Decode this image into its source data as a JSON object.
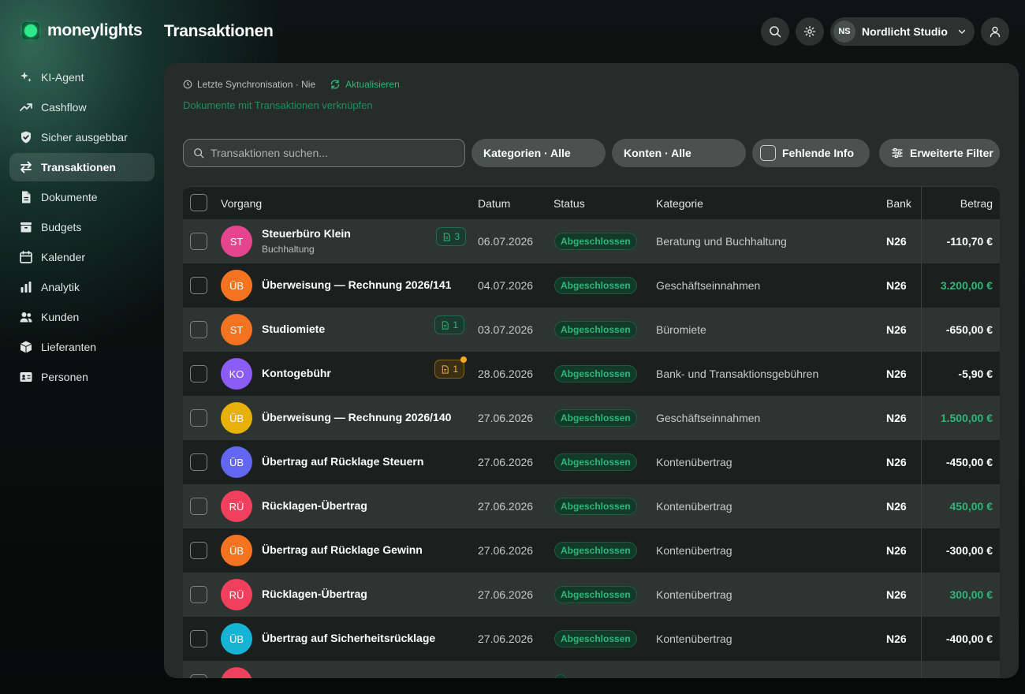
{
  "app": {
    "logo": "moneylights",
    "page_title": "Transaktionen"
  },
  "sidebar": {
    "items": [
      {
        "label": "KI-Agent",
        "icon": "sparkle-icon",
        "active": false
      },
      {
        "label": "Cashflow",
        "icon": "trend-up-icon",
        "active": false
      },
      {
        "label": "Sicher ausgebbar",
        "icon": "shield-check-icon",
        "active": false
      },
      {
        "label": "Transaktionen",
        "icon": "arrows-exchange-icon",
        "active": true
      },
      {
        "label": "Dokumente",
        "icon": "document-icon",
        "active": false
      },
      {
        "label": "Budgets",
        "icon": "wallet-icon",
        "active": false
      },
      {
        "label": "Kalender",
        "icon": "calendar-icon",
        "active": false
      },
      {
        "label": "Analytik",
        "icon": "bar-chart-icon",
        "active": false
      },
      {
        "label": "Kunden",
        "icon": "users-icon",
        "active": false
      },
      {
        "label": "Lieferanten",
        "icon": "box-icon",
        "active": false
      },
      {
        "label": "Personen",
        "icon": "id-card-icon",
        "active": false
      }
    ]
  },
  "header": {
    "org_initials": "NS",
    "org_name": "Nordlicht Studio"
  },
  "sync": {
    "label": "Letzte Synchronisation · Nie",
    "refresh_label": "Aktualisieren",
    "link_docs": "Dokumente mit Transaktionen verknüpfen"
  },
  "filters": {
    "search_placeholder": "Transaktionen suchen...",
    "categories": "Kategorien · Alle",
    "accounts": "Konten · Alle",
    "missing_info": "Fehlende Info",
    "advanced": "Erweiterte Filter"
  },
  "table": {
    "columns": {
      "vorgang": "Vorgang",
      "datum": "Datum",
      "status": "Status",
      "kategorie": "Kategorie",
      "bank": "Bank",
      "betrag": "Betrag"
    },
    "rows": [
      {
        "initials": "ST",
        "color": "#e5458f",
        "name": "Steuerbüro Klein",
        "sub": "Buchhaltung",
        "docs": "3",
        "doc_style": "green",
        "date": "06.07.2026",
        "status": "Abgeschlossen",
        "category": "Beratung und Buchhaltung",
        "bank": "N26",
        "amount": "-110,70 €",
        "positive": false
      },
      {
        "initials": "ÜB",
        "color": "#f37321",
        "name": "Überweisung — Rechnung 2026/141",
        "sub": "",
        "docs": "",
        "doc_style": "",
        "date": "04.07.2026",
        "status": "Abgeschlossen",
        "category": "Geschäftseinnahmen",
        "bank": "N26",
        "amount": "3.200,00 €",
        "positive": true
      },
      {
        "initials": "ST",
        "color": "#f37321",
        "name": "Studiomiete",
        "sub": "",
        "docs": "1",
        "doc_style": "green",
        "date": "03.07.2026",
        "status": "Abgeschlossen",
        "category": "Büromiete",
        "bank": "N26",
        "amount": "-650,00 €",
        "positive": false
      },
      {
        "initials": "KO",
        "color": "#8b5cf6",
        "name": "Kontogebühr",
        "sub": "",
        "docs": "1",
        "doc_style": "amber",
        "date": "28.06.2026",
        "status": "Abgeschlossen",
        "category": "Bank- und Transaktionsgebühren",
        "bank": "N26",
        "amount": "-5,90 €",
        "positive": false
      },
      {
        "initials": "ÜB",
        "color": "#e7b10a",
        "name": "Überweisung — Rechnung 2026/140",
        "sub": "",
        "docs": "",
        "doc_style": "",
        "date": "27.06.2026",
        "status": "Abgeschlossen",
        "category": "Geschäftseinnahmen",
        "bank": "N26",
        "amount": "1.500,00 €",
        "positive": true
      },
      {
        "initials": "ÜB",
        "color": "#6366f1",
        "name": "Übertrag auf Rücklage Steuern",
        "sub": "",
        "docs": "",
        "doc_style": "",
        "date": "27.06.2026",
        "status": "Abgeschlossen",
        "category": "Kontenübertrag",
        "bank": "N26",
        "amount": "-450,00 €",
        "positive": false
      },
      {
        "initials": "RÜ",
        "color": "#f0405e",
        "name": "Rücklagen-Übertrag",
        "sub": "",
        "docs": "",
        "doc_style": "",
        "date": "27.06.2026",
        "status": "Abgeschlossen",
        "category": "Kontenübertrag",
        "bank": "N26",
        "amount": "450,00 €",
        "positive": true
      },
      {
        "initials": "ÜB",
        "color": "#f37321",
        "name": "Übertrag auf Rücklage Gewinn",
        "sub": "",
        "docs": "",
        "doc_style": "",
        "date": "27.06.2026",
        "status": "Abgeschlossen",
        "category": "Kontenübertrag",
        "bank": "N26",
        "amount": "-300,00 €",
        "positive": false
      },
      {
        "initials": "RÜ",
        "color": "#f0405e",
        "name": "Rücklagen-Übertrag",
        "sub": "",
        "docs": "",
        "doc_style": "",
        "date": "27.06.2026",
        "status": "Abgeschlossen",
        "category": "Kontenübertrag",
        "bank": "N26",
        "amount": "300,00 €",
        "positive": true
      },
      {
        "initials": "ÜB",
        "color": "#15b3d4",
        "name": "Übertrag auf Sicherheitsrücklage",
        "sub": "",
        "docs": "",
        "doc_style": "",
        "date": "27.06.2026",
        "status": "Abgeschlossen",
        "category": "Kontenübertrag",
        "bank": "N26",
        "amount": "-400,00 €",
        "positive": false
      },
      {
        "initials": "",
        "color": "#f0405e",
        "name": "",
        "sub": "",
        "docs": "",
        "doc_style": "",
        "date": "",
        "status": "",
        "category": "",
        "bank": "",
        "amount": "",
        "positive": false
      }
    ]
  },
  "colors": {
    "accent": "#2fb777",
    "panel": "#262c2a",
    "row_light": "#2e3432",
    "row_dark": "#1b201f"
  }
}
